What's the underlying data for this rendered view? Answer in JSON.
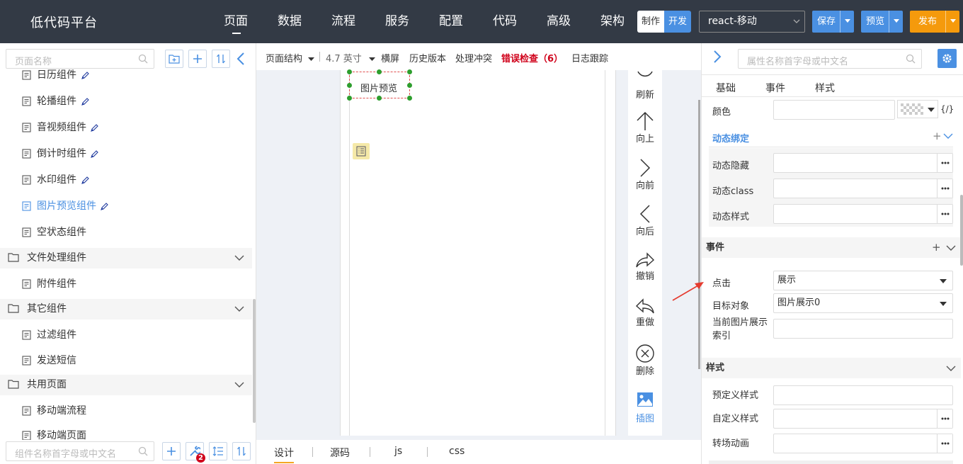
{
  "app": {
    "title": "低代码平台"
  },
  "nav": [
    "页面",
    "数据",
    "流程",
    "服务",
    "配置",
    "代码",
    "高级",
    "架构"
  ],
  "mode": [
    "制作",
    "开发"
  ],
  "project": "react-移动",
  "actions": {
    "save": "保存",
    "preview": "预览",
    "publish": "发布"
  },
  "left": {
    "search_placeholder": "页面名称",
    "bottom_search_placeholder": "组件名称首字母或中文名",
    "badge": "2",
    "tree": [
      {
        "type": "leaf",
        "label": "日历组件",
        "pen": true
      },
      {
        "type": "leaf",
        "label": "轮播组件",
        "pen": true
      },
      {
        "type": "leaf",
        "label": "音视频组件",
        "pen": true
      },
      {
        "type": "leaf",
        "label": "倒计时组件",
        "pen": true
      },
      {
        "type": "leaf",
        "label": "水印组件",
        "pen": true
      },
      {
        "type": "leaf",
        "label": "图片预览组件",
        "pen": true,
        "selected": true
      },
      {
        "type": "leaf",
        "label": "空状态组件",
        "pen": false
      },
      {
        "type": "folder",
        "label": "文件处理组件"
      },
      {
        "type": "leaf",
        "label": "附件组件",
        "pen": false
      },
      {
        "type": "folder",
        "label": "其它组件"
      },
      {
        "type": "leaf",
        "label": "过滤组件",
        "pen": false
      },
      {
        "type": "leaf",
        "label": "发送短信",
        "pen": false
      },
      {
        "type": "folder",
        "label": "共用页面"
      },
      {
        "type": "leaf",
        "label": "移动端流程",
        "pen": false
      },
      {
        "type": "leaf",
        "label": "移动端页面",
        "pen": false
      }
    ]
  },
  "toolbar": {
    "structure": "页面结构",
    "size": "4.7 英寸",
    "landscape": "横屏",
    "history": "历史版本",
    "conflict": "处理冲突",
    "error": "错误检查（6）",
    "log": "日志跟踪"
  },
  "canvas": {
    "component_label": "图片预览"
  },
  "side_tools": [
    "刷新",
    "向上",
    "向前",
    "向后",
    "撤销",
    "重做",
    "删除",
    "插图"
  ],
  "bottom_tabs": [
    "设计",
    "源码",
    "js",
    "css"
  ],
  "right": {
    "search_placeholder": "属性名称首字母或中文名",
    "tabs": [
      "基础",
      "事件",
      "样式"
    ],
    "color_label": "颜色",
    "formula": "{/}",
    "dynamic_title": "动态绑定",
    "dynamic_rows": [
      "动态隐藏",
      "动态class",
      "动态样式"
    ],
    "events_title": "事件",
    "click_label": "点击",
    "click_value": "展示",
    "target_label": "目标对象",
    "target_value": "图片展示0",
    "index_label": "当前图片展示索引",
    "style_title": "样式",
    "style_rows": [
      "预定义样式",
      "自定义样式",
      "转场动画"
    ]
  }
}
